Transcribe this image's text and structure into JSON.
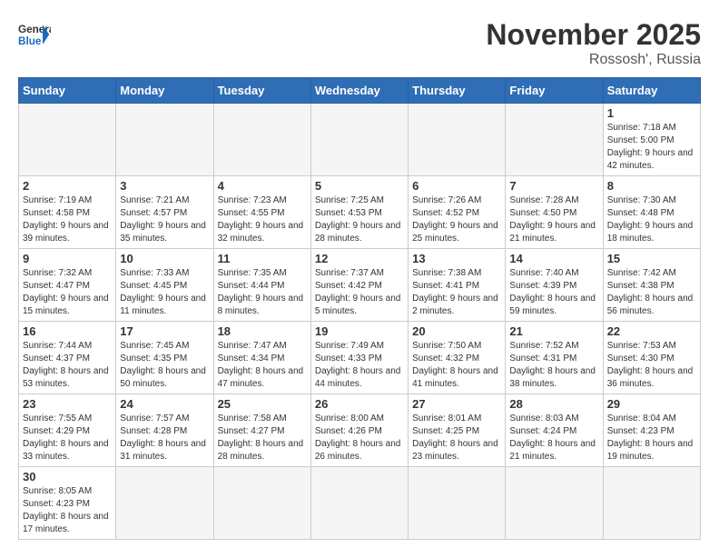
{
  "logo": {
    "general": "General",
    "blue": "Blue"
  },
  "title": "November 2025",
  "location": "Rossosh', Russia",
  "headers": [
    "Sunday",
    "Monday",
    "Tuesday",
    "Wednesday",
    "Thursday",
    "Friday",
    "Saturday"
  ],
  "weeks": [
    [
      {
        "day": null,
        "info": ""
      },
      {
        "day": null,
        "info": ""
      },
      {
        "day": null,
        "info": ""
      },
      {
        "day": null,
        "info": ""
      },
      {
        "day": null,
        "info": ""
      },
      {
        "day": null,
        "info": ""
      },
      {
        "day": "1",
        "info": "Sunrise: 7:18 AM\nSunset: 5:00 PM\nDaylight: 9 hours and 42 minutes."
      }
    ],
    [
      {
        "day": "2",
        "info": "Sunrise: 7:19 AM\nSunset: 4:58 PM\nDaylight: 9 hours and 39 minutes."
      },
      {
        "day": "3",
        "info": "Sunrise: 7:21 AM\nSunset: 4:57 PM\nDaylight: 9 hours and 35 minutes."
      },
      {
        "day": "4",
        "info": "Sunrise: 7:23 AM\nSunset: 4:55 PM\nDaylight: 9 hours and 32 minutes."
      },
      {
        "day": "5",
        "info": "Sunrise: 7:25 AM\nSunset: 4:53 PM\nDaylight: 9 hours and 28 minutes."
      },
      {
        "day": "6",
        "info": "Sunrise: 7:26 AM\nSunset: 4:52 PM\nDaylight: 9 hours and 25 minutes."
      },
      {
        "day": "7",
        "info": "Sunrise: 7:28 AM\nSunset: 4:50 PM\nDaylight: 9 hours and 21 minutes."
      },
      {
        "day": "8",
        "info": "Sunrise: 7:30 AM\nSunset: 4:48 PM\nDaylight: 9 hours and 18 minutes."
      }
    ],
    [
      {
        "day": "9",
        "info": "Sunrise: 7:32 AM\nSunset: 4:47 PM\nDaylight: 9 hours and 15 minutes."
      },
      {
        "day": "10",
        "info": "Sunrise: 7:33 AM\nSunset: 4:45 PM\nDaylight: 9 hours and 11 minutes."
      },
      {
        "day": "11",
        "info": "Sunrise: 7:35 AM\nSunset: 4:44 PM\nDaylight: 9 hours and 8 minutes."
      },
      {
        "day": "12",
        "info": "Sunrise: 7:37 AM\nSunset: 4:42 PM\nDaylight: 9 hours and 5 minutes."
      },
      {
        "day": "13",
        "info": "Sunrise: 7:38 AM\nSunset: 4:41 PM\nDaylight: 9 hours and 2 minutes."
      },
      {
        "day": "14",
        "info": "Sunrise: 7:40 AM\nSunset: 4:39 PM\nDaylight: 8 hours and 59 minutes."
      },
      {
        "day": "15",
        "info": "Sunrise: 7:42 AM\nSunset: 4:38 PM\nDaylight: 8 hours and 56 minutes."
      }
    ],
    [
      {
        "day": "16",
        "info": "Sunrise: 7:44 AM\nSunset: 4:37 PM\nDaylight: 8 hours and 53 minutes."
      },
      {
        "day": "17",
        "info": "Sunrise: 7:45 AM\nSunset: 4:35 PM\nDaylight: 8 hours and 50 minutes."
      },
      {
        "day": "18",
        "info": "Sunrise: 7:47 AM\nSunset: 4:34 PM\nDaylight: 8 hours and 47 minutes."
      },
      {
        "day": "19",
        "info": "Sunrise: 7:49 AM\nSunset: 4:33 PM\nDaylight: 8 hours and 44 minutes."
      },
      {
        "day": "20",
        "info": "Sunrise: 7:50 AM\nSunset: 4:32 PM\nDaylight: 8 hours and 41 minutes."
      },
      {
        "day": "21",
        "info": "Sunrise: 7:52 AM\nSunset: 4:31 PM\nDaylight: 8 hours and 38 minutes."
      },
      {
        "day": "22",
        "info": "Sunrise: 7:53 AM\nSunset: 4:30 PM\nDaylight: 8 hours and 36 minutes."
      }
    ],
    [
      {
        "day": "23",
        "info": "Sunrise: 7:55 AM\nSunset: 4:29 PM\nDaylight: 8 hours and 33 minutes."
      },
      {
        "day": "24",
        "info": "Sunrise: 7:57 AM\nSunset: 4:28 PM\nDaylight: 8 hours and 31 minutes."
      },
      {
        "day": "25",
        "info": "Sunrise: 7:58 AM\nSunset: 4:27 PM\nDaylight: 8 hours and 28 minutes."
      },
      {
        "day": "26",
        "info": "Sunrise: 8:00 AM\nSunset: 4:26 PM\nDaylight: 8 hours and 26 minutes."
      },
      {
        "day": "27",
        "info": "Sunrise: 8:01 AM\nSunset: 4:25 PM\nDaylight: 8 hours and 23 minutes."
      },
      {
        "day": "28",
        "info": "Sunrise: 8:03 AM\nSunset: 4:24 PM\nDaylight: 8 hours and 21 minutes."
      },
      {
        "day": "29",
        "info": "Sunrise: 8:04 AM\nSunset: 4:23 PM\nDaylight: 8 hours and 19 minutes."
      }
    ],
    [
      {
        "day": "30",
        "info": "Sunrise: 8:05 AM\nSunset: 4:23 PM\nDaylight: 8 hours and 17 minutes."
      },
      {
        "day": null,
        "info": ""
      },
      {
        "day": null,
        "info": ""
      },
      {
        "day": null,
        "info": ""
      },
      {
        "day": null,
        "info": ""
      },
      {
        "day": null,
        "info": ""
      },
      {
        "day": null,
        "info": ""
      }
    ]
  ]
}
